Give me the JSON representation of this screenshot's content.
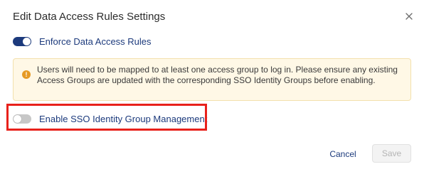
{
  "dialog": {
    "title": "Edit Data Access Rules Settings",
    "close_icon": "close-icon"
  },
  "toggles": {
    "enforce": {
      "label": "Enforce Data Access Rules",
      "enabled": true
    },
    "sso": {
      "label": "Enable SSO Identity Group Management",
      "enabled": false
    }
  },
  "alert": {
    "icon": "warning-icon",
    "icon_glyph": "!",
    "text": "Users will need to be mapped to at least one access group to log in. Please ensure any existing Access Groups are updated with the corresponding SSO Identity Groups before enabling."
  },
  "footer": {
    "cancel_label": "Cancel",
    "save_label": "Save",
    "save_disabled": true
  },
  "colors": {
    "accent": "#1c3a7c",
    "warning_bg": "#fff8e6",
    "warning_icon": "#e69a24",
    "highlight_border": "#e8211b"
  }
}
